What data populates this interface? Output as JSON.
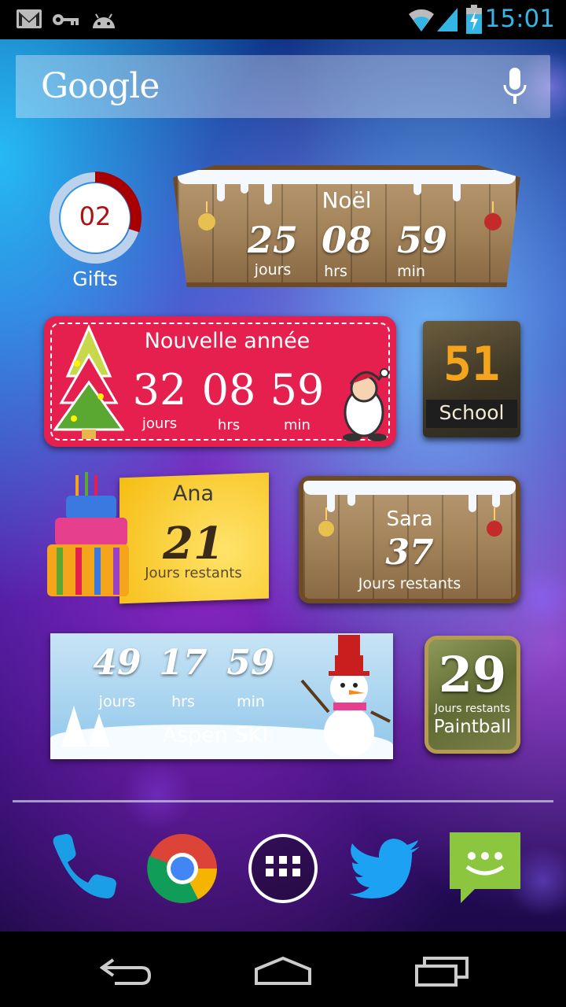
{
  "status_bar": {
    "time": "15:01",
    "icons": [
      "gmail-icon",
      "key-icon",
      "android-icon",
      "wifi-icon",
      "signal-icon",
      "battery-charging-icon"
    ]
  },
  "search": {
    "logo": "Google",
    "mic_icon": "mic-icon"
  },
  "widgets": {
    "gifts": {
      "count": "02",
      "label": "Gifts",
      "progress": 0.3,
      "color": "#a80000"
    },
    "noel": {
      "title": "Noël",
      "days": "25",
      "hours": "08",
      "minutes": "59",
      "days_label": "jours",
      "hours_label": "hrs",
      "minutes_label": "min"
    },
    "nouvelle_annee": {
      "title": "Nouvelle année",
      "days": "32",
      "hours": "08",
      "minutes": "59",
      "days_label": "jours",
      "hours_label": "hrs",
      "minutes_label": "min",
      "color": "#e5204f"
    },
    "school": {
      "count": "51",
      "label": "School"
    },
    "ana": {
      "name": "Ana",
      "count": "21",
      "label": "Jours restants"
    },
    "sara": {
      "name": "Sara",
      "count": "37",
      "label": "Jours restants"
    },
    "aspen": {
      "title": "Aspen SKI",
      "days": "49",
      "hours": "17",
      "minutes": "59",
      "days_label": "jours",
      "hours_label": "hrs",
      "minutes_label": "min"
    },
    "paintball": {
      "count": "29",
      "sub": "Jours restants",
      "label": "Paintball"
    }
  },
  "dock": [
    "phone-icon",
    "chrome-icon",
    "app-drawer-icon",
    "twitter-icon",
    "messaging-icon"
  ],
  "nav": [
    "back-icon",
    "home-icon",
    "recents-icon"
  ],
  "colors": {
    "accent": "#33b5e5"
  }
}
